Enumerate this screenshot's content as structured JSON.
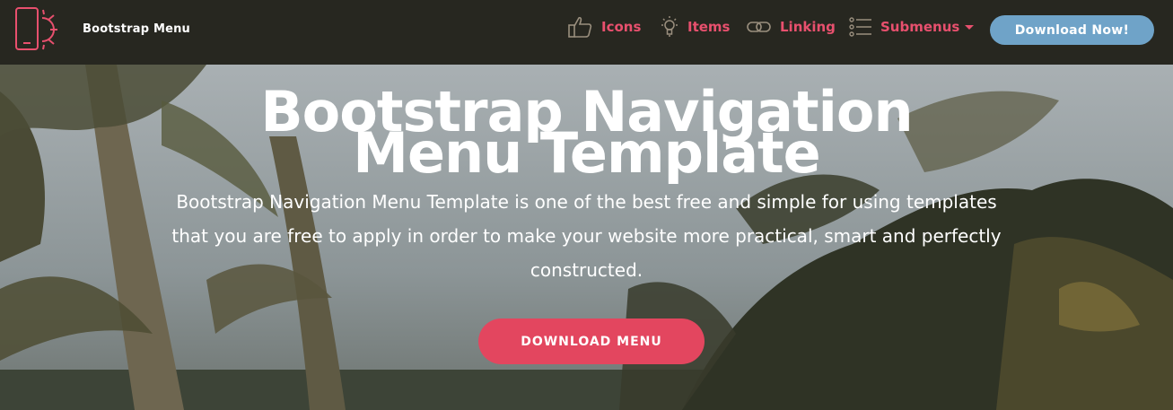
{
  "navbar": {
    "brand_name": "Bootstrap Menu",
    "brand_icon": "phone-sun-icon",
    "links": [
      {
        "label": "Icons",
        "icon": "thumbs-up-icon"
      },
      {
        "label": "Items",
        "icon": "lightbulb-icon"
      },
      {
        "label": "Linking",
        "icon": "link-icon"
      },
      {
        "label": "Submenus",
        "icon": "list-icon"
      }
    ],
    "cta_label": "Download Now!"
  },
  "hero": {
    "title_line1": "Bootstrap Navigation",
    "title_line2": "Menu Template",
    "description": "Bootstrap Navigation Menu Template is one of the best free and simple for using templates that you are free to apply in order to make your website more practical, smart and perfectly constructed.",
    "button_label": "DOWNLOAD MENU"
  },
  "colors": {
    "navbar_bg": "#272720",
    "accent_pink": "#e8506e",
    "cta_blue": "#6fa3c8",
    "hero_button": "#e3465f",
    "text_white": "#ffffff"
  }
}
